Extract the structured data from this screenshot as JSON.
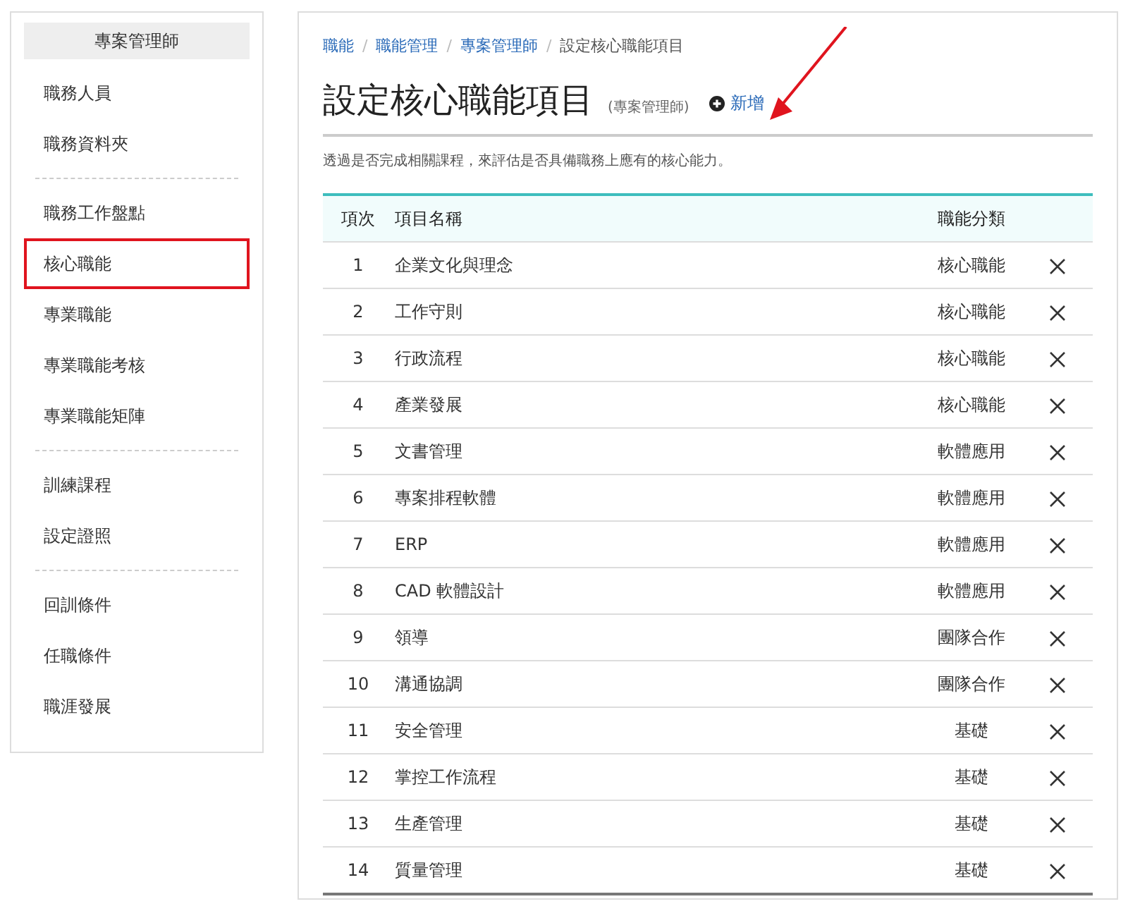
{
  "sidebar": {
    "title": "專案管理師",
    "groups": [
      {
        "items": [
          {
            "label": "職務人員",
            "selected": false
          },
          {
            "label": "職務資料夾",
            "selected": false
          }
        ]
      },
      {
        "items": [
          {
            "label": "職務工作盤點",
            "selected": false
          },
          {
            "label": "核心職能",
            "selected": true
          },
          {
            "label": "專業職能",
            "selected": false
          },
          {
            "label": "專業職能考核",
            "selected": false
          },
          {
            "label": "專業職能矩陣",
            "selected": false
          }
        ]
      },
      {
        "items": [
          {
            "label": "訓練課程",
            "selected": false
          },
          {
            "label": "設定證照",
            "selected": false
          }
        ]
      },
      {
        "items": [
          {
            "label": "回訓條件",
            "selected": false
          },
          {
            "label": "任職條件",
            "selected": false
          },
          {
            "label": "職涯發展",
            "selected": false
          }
        ]
      }
    ]
  },
  "breadcrumb": {
    "links": [
      {
        "label": "職能",
        "separator": "/"
      },
      {
        "label": "職能管理",
        "separator": "/"
      },
      {
        "label": "專案管理師",
        "separator": "/"
      }
    ],
    "current": "設定核心職能項目"
  },
  "page": {
    "title": "設定核心職能項目",
    "subtitle": "(專案管理師)",
    "add_button": "新增",
    "description": "透過是否完成相關課程，來評估是否具備職務上應有的核心能力。"
  },
  "table": {
    "columns": [
      "項次",
      "項目名稱",
      "職能分類"
    ],
    "rows": [
      {
        "index": "1",
        "name": "企業文化與理念",
        "category": "核心職能"
      },
      {
        "index": "2",
        "name": "工作守則",
        "category": "核心職能"
      },
      {
        "index": "3",
        "name": "行政流程",
        "category": "核心職能"
      },
      {
        "index": "4",
        "name": "產業發展",
        "category": "核心職能"
      },
      {
        "index": "5",
        "name": "文書管理",
        "category": "軟體應用"
      },
      {
        "index": "6",
        "name": "專案排程軟體",
        "category": "軟體應用"
      },
      {
        "index": "7",
        "name": "ERP",
        "category": "軟體應用"
      },
      {
        "index": "8",
        "name": "CAD 軟體設計",
        "category": "軟體應用"
      },
      {
        "index": "9",
        "name": "領導",
        "category": "團隊合作"
      },
      {
        "index": "10",
        "name": "溝通協調",
        "category": "團隊合作"
      },
      {
        "index": "11",
        "name": "安全管理",
        "category": "基礎"
      },
      {
        "index": "12",
        "name": "掌控工作流程",
        "category": "基礎"
      },
      {
        "index": "13",
        "name": "生產管理",
        "category": "基礎"
      },
      {
        "index": "14",
        "name": "質量管理",
        "category": "基礎"
      }
    ]
  }
}
